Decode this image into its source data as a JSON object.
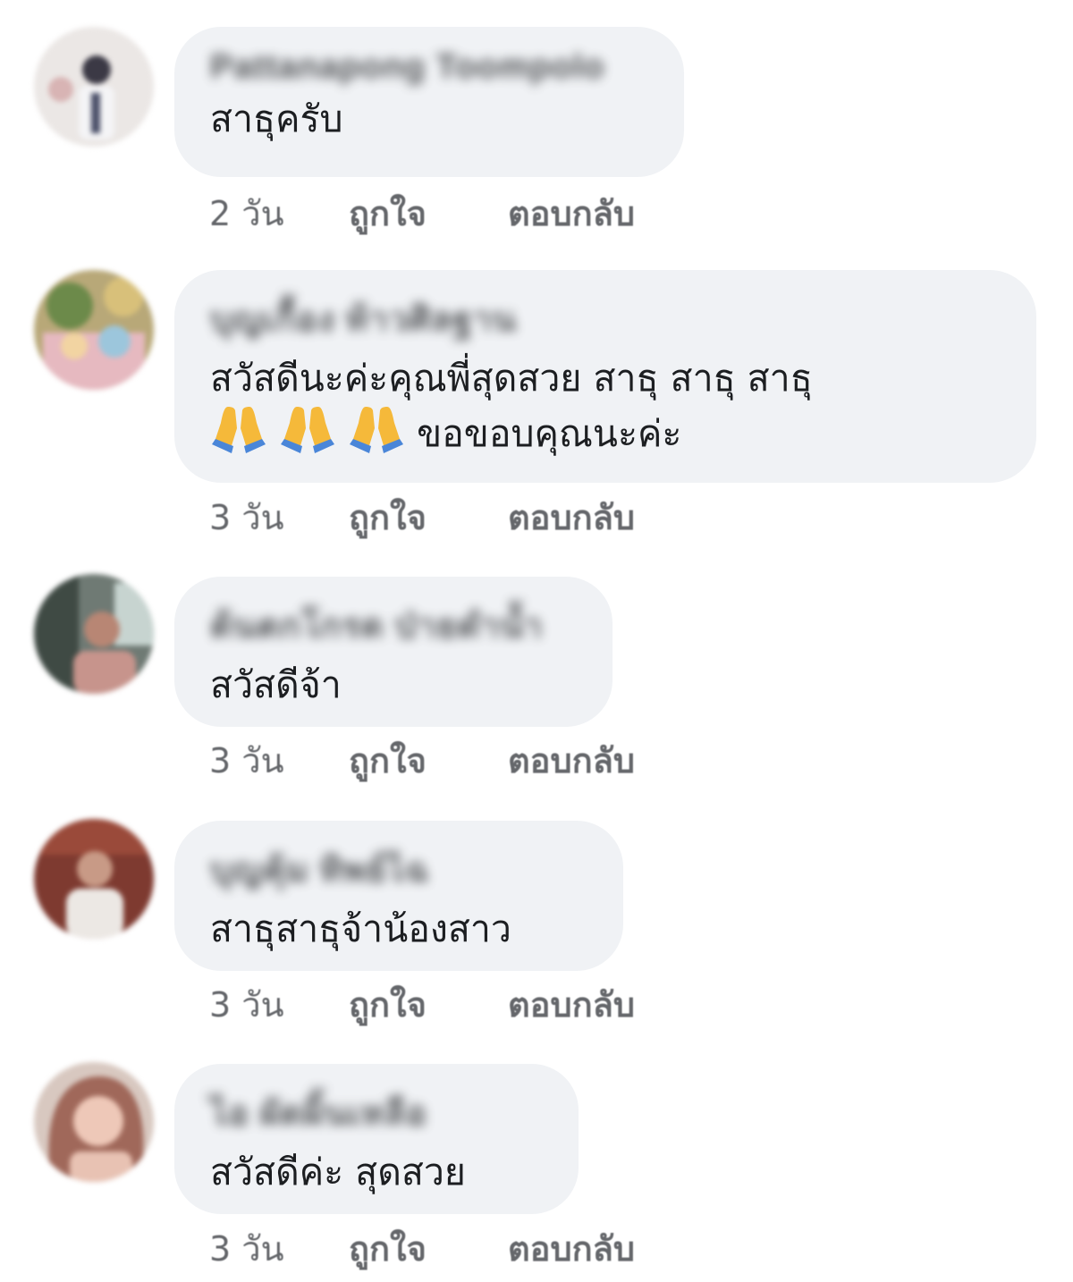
{
  "comments": [
    {
      "author": "Pattanapong Toompolo",
      "text": "สาธุครับ",
      "time": "2 วัน",
      "like": "ถูกใจ",
      "reply": "ตอบกลับ",
      "colors": {
        "avatar_bg": "#e9e4e2",
        "avatar_fg": "#5c5866"
      }
    },
    {
      "author": "บุญเกื้อง ท้าวศิลฐาน",
      "text_line1": "สวัสดีนะค่ะคุณพี่สุดสวย สาธุ สาธุ สาธุ",
      "text_line2": "ขอขอบคุณนะค่ะ",
      "emoji": "folded-hands",
      "time": "3 วัน",
      "like": "ถูกใจ",
      "reply": "ตอบกลับ",
      "colors": {
        "avatar_bg": "#c9a86c",
        "avatar_fg": "#9ec0d6"
      }
    },
    {
      "author": "ต้นตกโกรด ป่ายดำน้ำ",
      "text": "สวัสดีจ้า",
      "time": "3 วัน",
      "like": "ถูกใจ",
      "reply": "ตอบกลับ",
      "colors": {
        "avatar_bg": "#6f7a74",
        "avatar_fg": "#c7948c"
      }
    },
    {
      "author": "บุญคุ้ม ทิพย์ไฉ",
      "text": "สาธุสาธุจ้าน้องสาว",
      "time": "3 วัน",
      "like": "ถูกใจ",
      "reply": "ตอบกลับ",
      "colors": {
        "avatar_bg": "#8a3c32",
        "avatar_fg": "#e5e0dc"
      }
    },
    {
      "author": "ไอ ผัดผิ้นเหลือ",
      "text": "สวัสดีค่ะ สุดสวย",
      "time": "3 วัน",
      "like": "ถูกใจ",
      "reply": "ตอบกลับ",
      "colors": {
        "avatar_bg": "#b98f7e",
        "avatar_fg": "#e8c2b3"
      }
    }
  ],
  "theme": {
    "bubble_bg": "#f0f2f5",
    "text_color": "#1c1e21",
    "meta_color": "#65676b"
  }
}
